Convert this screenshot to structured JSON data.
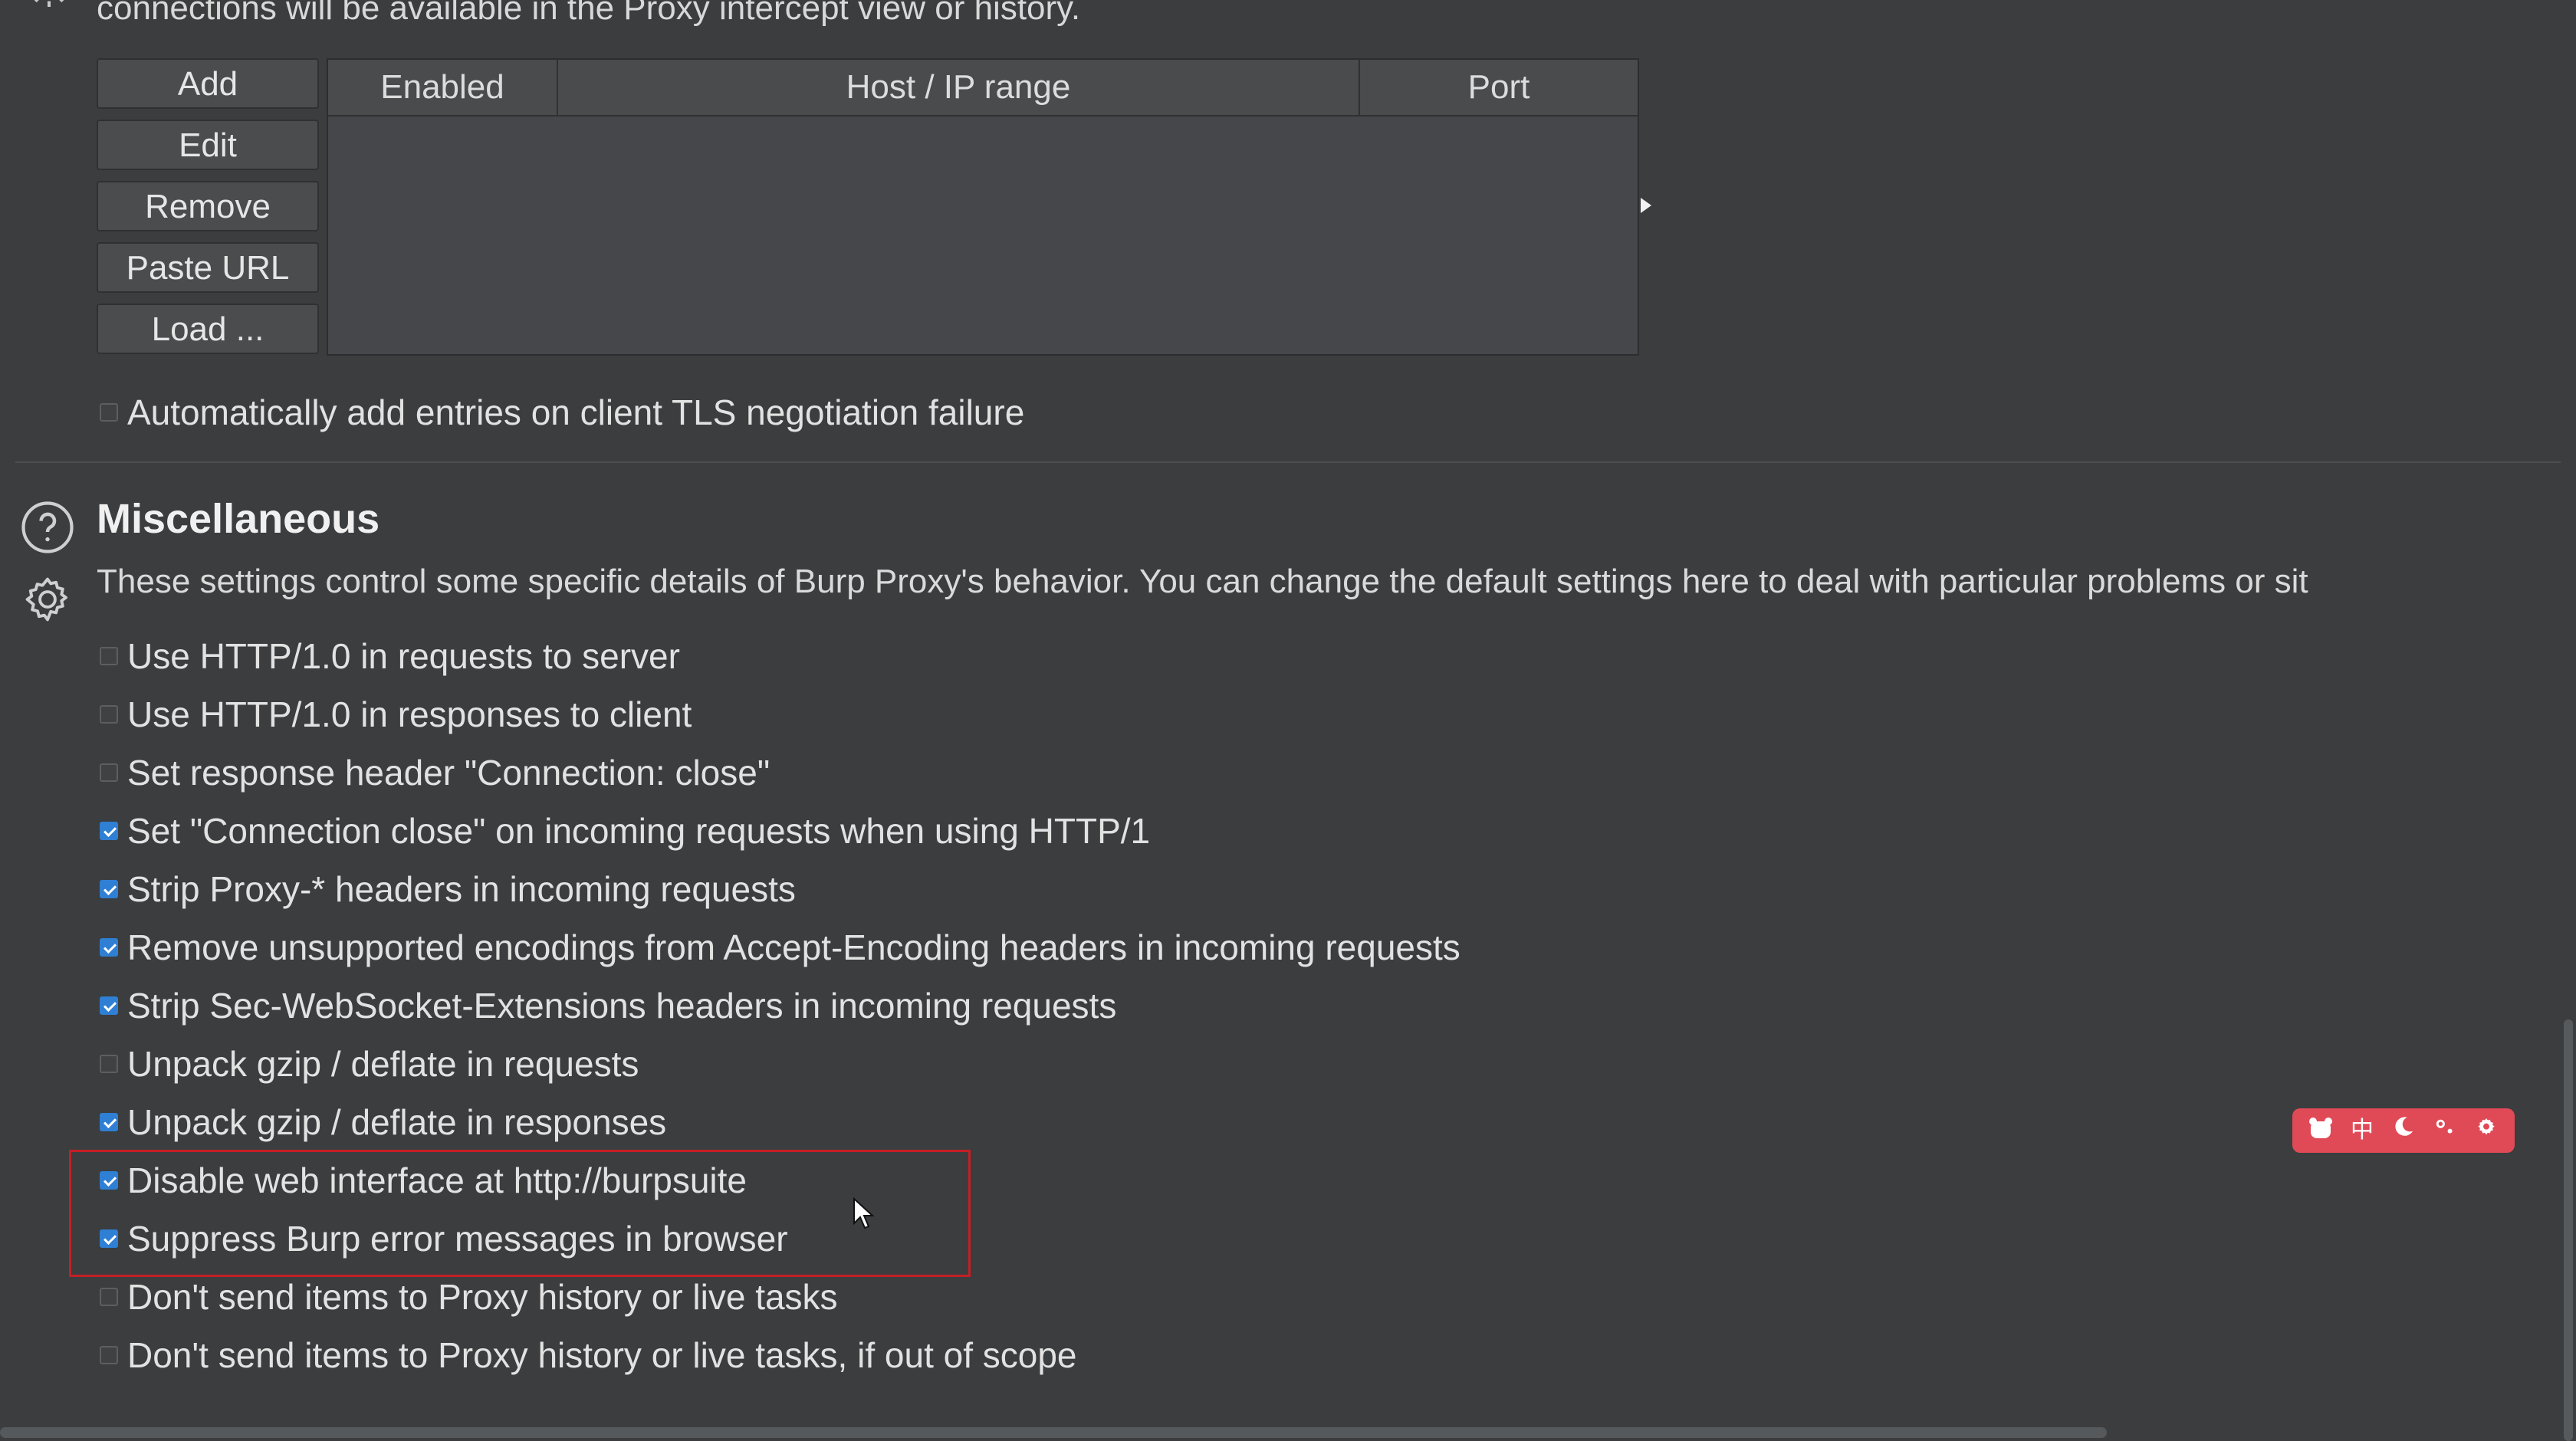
{
  "top_partial_text": "connections will be available in the Proxy intercept view or history.",
  "tls_buttons": {
    "add": "Add",
    "edit": "Edit",
    "remove": "Remove",
    "paste_url": "Paste URL",
    "load": "Load ..."
  },
  "tls_table": {
    "columns": [
      "Enabled",
      "Host / IP range",
      "Port"
    ],
    "rows": []
  },
  "auto_add_option": {
    "label": "Automatically add entries on client TLS negotiation failure",
    "checked": false
  },
  "misc": {
    "title": "Miscellaneous",
    "description": "These settings control some specific details of Burp Proxy's behavior. You can change the default settings here to deal with particular problems or sit",
    "options": [
      {
        "label": "Use HTTP/1.0 in requests to server",
        "checked": false
      },
      {
        "label": "Use HTTP/1.0 in responses to client",
        "checked": false
      },
      {
        "label": "Set response header \"Connection: close\"",
        "checked": false
      },
      {
        "label": "Set \"Connection close\" on incoming requests when using HTTP/1",
        "checked": true
      },
      {
        "label": "Strip Proxy-* headers in incoming requests",
        "checked": true
      },
      {
        "label": "Remove unsupported encodings from Accept-Encoding headers in incoming requests",
        "checked": true
      },
      {
        "label": "Strip Sec-WebSocket-Extensions headers in incoming requests",
        "checked": true
      },
      {
        "label": "Unpack gzip / deflate in requests",
        "checked": false
      },
      {
        "label": "Unpack gzip / deflate in responses",
        "checked": true
      },
      {
        "label": "Disable web interface at http://burpsuite",
        "checked": true
      },
      {
        "label": "Suppress Burp error messages in browser",
        "checked": true
      },
      {
        "label": "Don't send items to Proxy history or live tasks",
        "checked": false
      },
      {
        "label": "Don't send items to Proxy history or live tasks, if out of scope",
        "checked": false
      }
    ]
  },
  "floating_toolbar": {
    "icons": [
      "bear-icon",
      "chinese-char",
      "moon-icon",
      "dots-icon",
      "gear-icon"
    ],
    "chinese_char": "中",
    "bg_color": "#e04a57"
  },
  "colors": {
    "background": "#3b3d3f",
    "checkbox_on": "#2f7fd4",
    "highlight_border": "#c41f25"
  }
}
